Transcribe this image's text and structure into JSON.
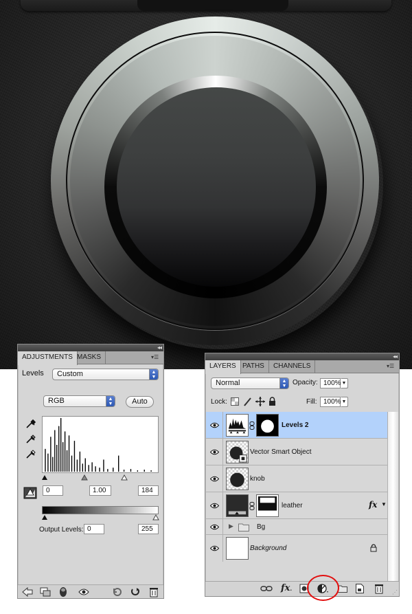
{
  "adjustments_panel": {
    "tabs": [
      {
        "label": "ADJUSTMENTS",
        "active": true
      },
      {
        "label": "MASKS",
        "active": false
      }
    ],
    "preset_label": "Levels",
    "preset_value": "Custom",
    "channel_value": "RGB",
    "auto_label": "Auto",
    "input_black": "0",
    "input_gamma": "1.00",
    "input_white": "184",
    "output_label": "Output Levels:",
    "output_black": "0",
    "output_white": "255",
    "icons": [
      "eyedropper-black-icon",
      "eyedropper-gray-icon",
      "eyedropper-white-icon",
      "clipping-warning-icon",
      "back-arrow-icon",
      "clip-to-layer-icon",
      "toggle-visibility-mask-icon",
      "eye-icon",
      "previous-state-icon",
      "reset-icon",
      "trash-icon"
    ]
  },
  "layers_panel": {
    "tabs": [
      {
        "label": "LAYERS",
        "active": true
      },
      {
        "label": "PATHS",
        "active": false
      },
      {
        "label": "CHANNELS",
        "active": false
      }
    ],
    "blend_mode": "Normal",
    "opacity_label": "Opacity:",
    "opacity_value": "100%",
    "lock_label": "Lock:",
    "fill_label": "Fill:",
    "fill_value": "100%",
    "layers": [
      {
        "name": "Levels 2",
        "selected": true,
        "type": "adjustment"
      },
      {
        "name": "Vector Smart Object",
        "selected": false,
        "type": "smart-object"
      },
      {
        "name": "knob",
        "selected": false,
        "type": "pixel"
      },
      {
        "name": "leather",
        "selected": false,
        "type": "pixel-with-mask",
        "fx": "fx"
      },
      {
        "name": "Bg",
        "selected": false,
        "type": "group"
      },
      {
        "name": "Background",
        "selected": false,
        "type": "background",
        "locked": true
      }
    ],
    "footer_icons": [
      "link-layers-icon",
      "add-layer-style-icon",
      "add-mask-icon",
      "new-adjustment-layer-icon",
      "new-group-icon",
      "new-layer-icon",
      "delete-layer-icon"
    ]
  },
  "colors": {
    "selection_blue": "#b3d2fb",
    "annotation_red": "#e20e0e",
    "panel_gray": "#d6d6d6"
  }
}
